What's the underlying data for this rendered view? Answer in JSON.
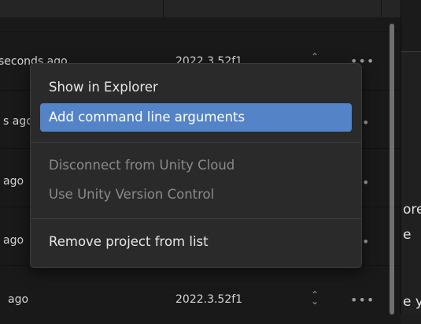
{
  "rows": [
    {
      "time": "seconds ago",
      "version": "2022.3.52f1"
    },
    {
      "time": "s ago"
    },
    {
      "time": "ago"
    },
    {
      "time": "ago"
    },
    {
      "time": "ago",
      "version": "2022.3.52f1"
    }
  ],
  "context_menu": {
    "items": [
      {
        "label": "Show in Explorer",
        "enabled": true
      },
      {
        "label": "Add command line arguments",
        "enabled": true,
        "highlighted": true
      },
      {
        "label": "Disconnect from Unity Cloud",
        "enabled": false
      },
      {
        "label": "Use Unity Version Control",
        "enabled": false
      },
      {
        "label": "Remove project from list",
        "enabled": true
      }
    ]
  },
  "right_panel": {
    "fragments": [
      "ores",
      "e",
      "e y"
    ]
  },
  "icons": {
    "more": "more-horizontal-icon",
    "sort": "sort-chevrons-icon"
  }
}
